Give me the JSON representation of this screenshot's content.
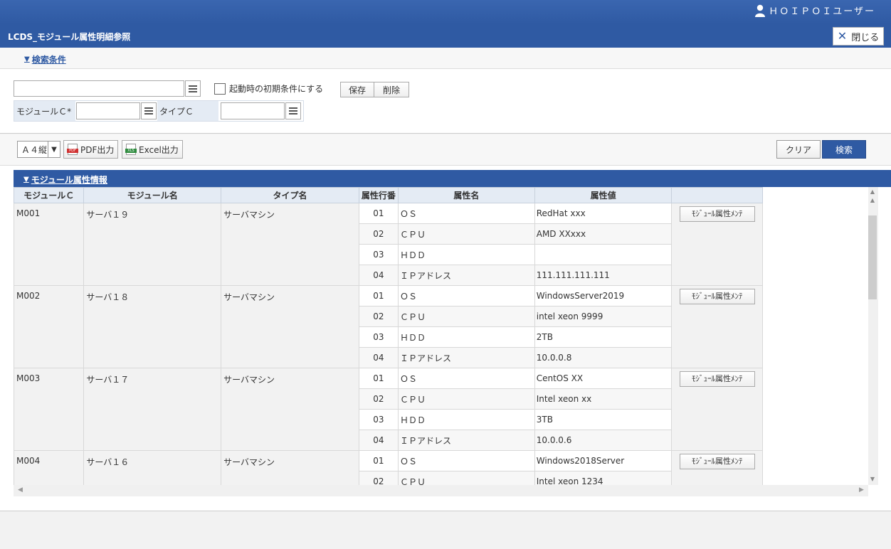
{
  "header": {
    "user_name": "ＨＯＩＰＯＩユーザー",
    "title": "LCDS_モジュール属性明細参照",
    "close_label": "閉じる"
  },
  "search": {
    "toggle_label": "検索条件",
    "init_condition_label": "起動時の初期条件にする",
    "save_label": "保存",
    "delete_label": "削除",
    "module_c_label": "モジュールＣ*",
    "type_c_label": "タイプＣ"
  },
  "toolbar": {
    "paper_size": "Ａ４縦",
    "pdf_label": "PDF出力",
    "excel_label": "Excel出力",
    "clear_label": "クリア",
    "search_label": "検索"
  },
  "results": {
    "section_title": "モジュール属性情報",
    "columns": [
      "モジュールＣ",
      "モジュール名",
      "タイプ名",
      "属性行番",
      "属性名",
      "属性値",
      ""
    ],
    "maint_label": "ﾓｼﾞｭｰﾙ属性ﾒﾝﾃ",
    "modules": [
      {
        "code": "M001",
        "name": "サーバ１９",
        "type": "サーバマシン",
        "attrs": [
          {
            "no": "01",
            "name": "ＯＳ",
            "value": "RedHat xxx"
          },
          {
            "no": "02",
            "name": "ＣＰＵ",
            "value": "AMD XXxxx"
          },
          {
            "no": "03",
            "name": "ＨＤＤ",
            "value": ""
          },
          {
            "no": "04",
            "name": "ＩＰアドレス",
            "value": "111.111.111.111"
          }
        ]
      },
      {
        "code": "M002",
        "name": "サーバ１８",
        "type": "サーバマシン",
        "attrs": [
          {
            "no": "01",
            "name": "ＯＳ",
            "value": "WindowsServer2019"
          },
          {
            "no": "02",
            "name": "ＣＰＵ",
            "value": "intel xeon 9999"
          },
          {
            "no": "03",
            "name": "ＨＤＤ",
            "value": "2TB"
          },
          {
            "no": "04",
            "name": "ＩＰアドレス",
            "value": "10.0.0.8"
          }
        ]
      },
      {
        "code": "M003",
        "name": "サーバ１７",
        "type": "サーバマシン",
        "attrs": [
          {
            "no": "01",
            "name": "ＯＳ",
            "value": "CentOS XX"
          },
          {
            "no": "02",
            "name": "ＣＰＵ",
            "value": "Intel xeon xx"
          },
          {
            "no": "03",
            "name": "ＨＤＤ",
            "value": "3TB"
          },
          {
            "no": "04",
            "name": "ＩＰアドレス",
            "value": "10.0.0.6"
          }
        ]
      },
      {
        "code": "M004",
        "name": "サーバ１６",
        "type": "サーバマシン",
        "attrs": [
          {
            "no": "01",
            "name": "ＯＳ",
            "value": "Windows2018Server"
          },
          {
            "no": "02",
            "name": "ＣＰＵ",
            "value": "Intel xeon 1234"
          }
        ]
      }
    ]
  },
  "icons": {
    "user": "user-icon",
    "close": "close-icon",
    "list": "list-icon",
    "pdf": "pdf-icon",
    "excel": "excel-icon",
    "collapse": "triangle-down-icon"
  },
  "colors": {
    "brand": "#2f5aa3",
    "label_bg": "#e4ebf4"
  }
}
